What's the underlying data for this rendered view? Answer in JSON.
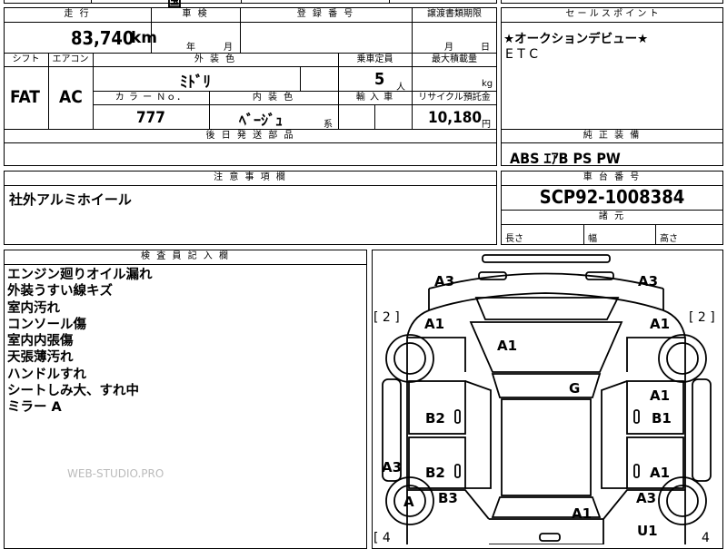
{
  "top_strip": {
    "partial_text": "国"
  },
  "mileage": {
    "label": "走 行",
    "value": "83,740",
    "unit": "km"
  },
  "inspection": {
    "label": "車 検",
    "year_unit": "年",
    "month_unit": "月"
  },
  "registration": {
    "label": "登 録 番 号"
  },
  "transfer": {
    "label": "譲渡書類期限",
    "month_unit": "月",
    "day_unit": "日"
  },
  "sales_point": {
    "label": "セ ー ル ス ポ イ ン ト",
    "lines": [
      "★オークションデビュー★",
      "E T C"
    ]
  },
  "shift": {
    "label": "シフト",
    "value": "FAT"
  },
  "aircon": {
    "label": "エアコン",
    "value": "AC"
  },
  "exterior_color": {
    "label": "外 装 色",
    "value": "ﾐﾄﾞﾘ"
  },
  "capacity": {
    "label": "乗車定員",
    "value": "5",
    "unit": "人"
  },
  "max_load": {
    "label": "最大積載量",
    "unit": "kg"
  },
  "color_no": {
    "label": "カ ラ ー Ｎｏ．",
    "value": "777"
  },
  "interior_color": {
    "label": "内 装 色",
    "value": "ﾍﾞｰｼﾞｭ",
    "suffix": "系"
  },
  "import": {
    "label": "輸 入 車"
  },
  "recycle": {
    "label": "リサイクル預託金",
    "value": "10,180",
    "unit": "円"
  },
  "later_parts": {
    "label": "後 日 発 送 部 品"
  },
  "equipment": {
    "label": "純 正 装 備",
    "value": "ABS ｴｱB PS PW"
  },
  "caution": {
    "label": "注 意 事 項 欄",
    "value": "社外アルミホイール"
  },
  "chassis": {
    "label": "車 台 番 号",
    "value": "SCP92-1008384"
  },
  "specs": {
    "label": "諸 元",
    "length": "長さ",
    "width": "幅",
    "height": "高さ"
  },
  "inspector": {
    "label": "検 査 員 記 入 欄",
    "notes": [
      "エンジン廻りオイル漏れ",
      "外装うすい線キズ",
      "室内汚れ",
      "コンソール傷",
      "室内内張傷",
      "天張薄汚れ",
      "ハンドルすれ",
      "シートしみ大、すれ中",
      "ミラー A"
    ]
  },
  "watermark": "WEB-STUDIO.PRO",
  "diagram": {
    "tire_bracket_fl": "[ 2 ]",
    "tire_bracket_fr": "[ 2 ]",
    "tire_bracket_rl": "[ 4",
    "tire_bracket_rr": "4",
    "marks": {
      "front_left": "A3",
      "front_right": "A3",
      "fender_left": "A1",
      "fender_right": "A1",
      "hood": "A1",
      "roof": "G",
      "door_fl": "B2",
      "door_fr": "A1",
      "door_fr_b": "B1",
      "door_rl": "B2",
      "door_rr": "A1",
      "side_left": "A3",
      "wheel_rl": "A",
      "quarter_left": "B3",
      "trunk": "A1",
      "quarter_right": "A3",
      "rear_right": "U1"
    }
  }
}
